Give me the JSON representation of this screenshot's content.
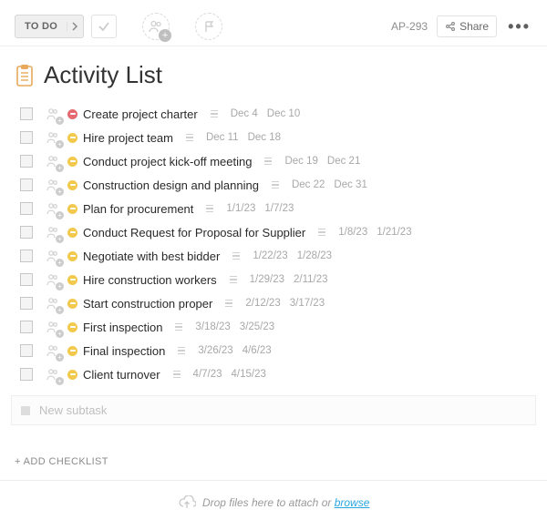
{
  "toolbar": {
    "status_label": "TO DO",
    "ticket_id": "AP-293",
    "share_label": "Share"
  },
  "title": "Activity List",
  "status_colors": {
    "red": "#e46a6f",
    "yellow": "#f2c94c"
  },
  "tasks": [
    {
      "name": "Create project charter",
      "start": "Dec 4",
      "end": "Dec 10",
      "status": "red"
    },
    {
      "name": "Hire project team",
      "start": "Dec 11",
      "end": "Dec 18",
      "status": "yellow"
    },
    {
      "name": "Conduct project kick-off meeting",
      "start": "Dec 19",
      "end": "Dec 21",
      "status": "yellow"
    },
    {
      "name": "Construction design and planning",
      "start": "Dec 22",
      "end": "Dec 31",
      "status": "yellow"
    },
    {
      "name": "Plan for procurement",
      "start": "1/1/23",
      "end": "1/7/23",
      "status": "yellow"
    },
    {
      "name": "Conduct Request for Proposal for Supplier",
      "start": "1/8/23",
      "end": "1/21/23",
      "status": "yellow"
    },
    {
      "name": "Negotiate with best bidder",
      "start": "1/22/23",
      "end": "1/28/23",
      "status": "yellow"
    },
    {
      "name": "Hire construction workers",
      "start": "1/29/23",
      "end": "2/11/23",
      "status": "yellow"
    },
    {
      "name": "Start construction proper",
      "start": "2/12/23",
      "end": "3/17/23",
      "status": "yellow"
    },
    {
      "name": "First inspection",
      "start": "3/18/23",
      "end": "3/25/23",
      "status": "yellow"
    },
    {
      "name": "Final inspection",
      "start": "3/26/23",
      "end": "4/6/23",
      "status": "yellow"
    },
    {
      "name": "Client turnover",
      "start": "4/7/23",
      "end": "4/15/23",
      "status": "yellow"
    }
  ],
  "new_subtask_placeholder": "New subtask",
  "add_checklist_label": "+ ADD CHECKLIST",
  "dropzone": {
    "text": "Drop files here to attach or ",
    "browse": "browse"
  }
}
